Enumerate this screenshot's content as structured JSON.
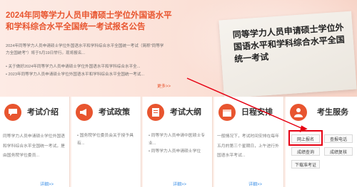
{
  "news": {
    "title": "2024年同等学力人员申请硕士学位外国语水平和学科综合水平全国统一考试报名公告",
    "summary": "2024年同等学力人员申请硕士学位外国语水平和学科综合水平全国统一考试（简称\"同等学力全国统考\"）将于5月19日举行。现将报名...",
    "items": [
      "• 关于做好2024年同等学力人员申请硕士学位外国语水平和学科综合水平全...",
      "• 2023年同等学力人员申请硕士学位外国语水平和学科综合水平全国统一考试..."
    ],
    "more": "更多>>"
  },
  "poster": {
    "text": "同等学力人员申请硕士学位外国语水平和学科综合水平全国统一考试"
  },
  "cards": {
    "exam_intro": {
      "title": "考试介绍",
      "body": "同等学力人员申请硕士学位外国语和学科综合水平全国统一考试，是由国务院学位委员...",
      "more": "详细>>"
    },
    "exam_policy": {
      "title": "考试政策",
      "items": [
        "• 国务院学位委员会关于授予具有..."
      ]
    },
    "exam_syllabus": {
      "title": "考试大纲",
      "items": [
        "• 同等学力人员申请中医硕士专业...",
        "• 同等学力人员申请硕士学位"
      ],
      "more": "详细>>"
    },
    "schedule": {
      "title": "日程安排",
      "body": "一般情况下，考试时间安排在每年五月的第三个星期日，上午进行外国语水平考试...",
      "more": "详细>>"
    },
    "services": {
      "title": "考生服务",
      "buttons": [
        "网上报名",
        "查报电话",
        "成绩查询",
        "成绩复核",
        "下载准考证"
      ]
    }
  },
  "colors": {
    "accent": "#e8552f",
    "highlight": "#e60012"
  }
}
